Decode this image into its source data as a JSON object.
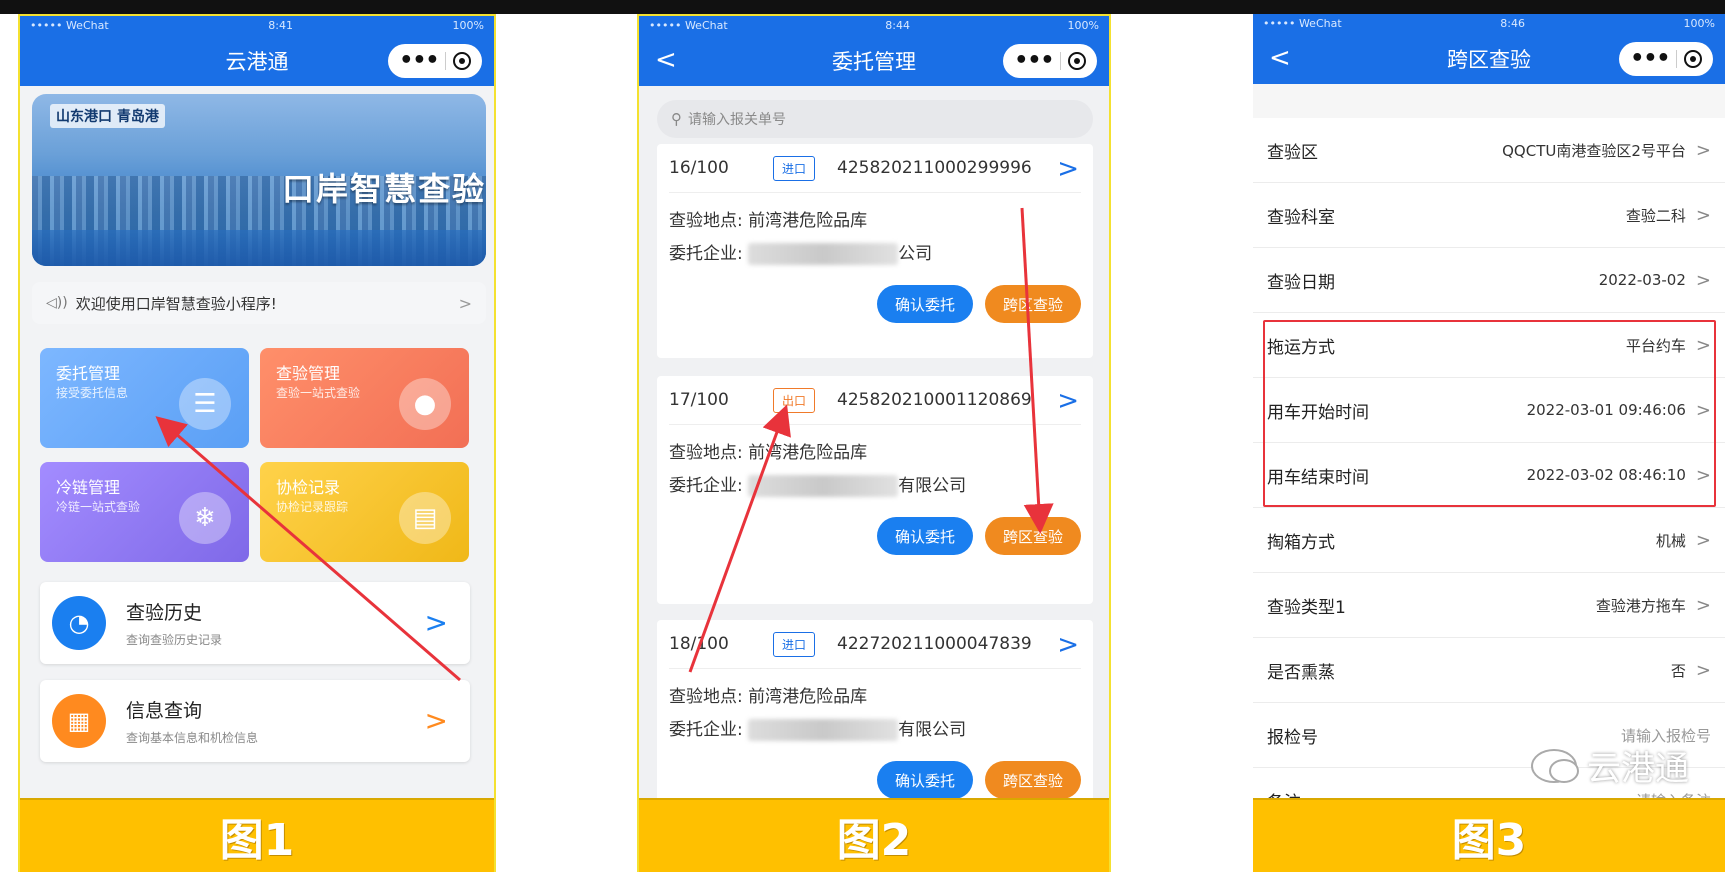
{
  "phones": {
    "p1": {
      "status": {
        "carrier": "••••• WeChat",
        "time": "8:41",
        "battery": "100%"
      },
      "title": "云港通",
      "banner": {
        "logo": "山东港口 青岛港",
        "title": "口岸智慧查验"
      },
      "notice": "欢迎使用口岸智慧查验小程序!",
      "tiles": [
        {
          "title": "委托管理",
          "subtitle": "接受委托信息",
          "icon": "hand-icon"
        },
        {
          "title": "查验管理",
          "subtitle": "查验一站式查验",
          "icon": "person-icon"
        },
        {
          "title": "冷链管理",
          "subtitle": "冷链一站式查验",
          "icon": "snowflake-icon"
        },
        {
          "title": "协检记录",
          "subtitle": "协检记录跟踪",
          "icon": "clipboard-icon"
        }
      ],
      "list": [
        {
          "title": "查验历史",
          "subtitle": "查询查验历史记录",
          "icon": "clock-icon"
        },
        {
          "title": "信息查询",
          "subtitle": "查询基本信息和机检信息",
          "icon": "layout-icon"
        }
      ],
      "figure": "图1"
    },
    "p2": {
      "status": {
        "carrier": "••••• WeChat",
        "time": "8:44",
        "battery": "100%"
      },
      "title": "委托管理",
      "search_placeholder": "请输入报关单号",
      "orders": [
        {
          "num": "16/100",
          "tag": "进口",
          "tag_type": "in",
          "code": "425820211000299996",
          "location_label": "查验地点:",
          "location": "前湾港危险品库",
          "company_label": "委托企业:",
          "company_suffix": "公司",
          "btn_confirm": "确认委托",
          "btn_cross": "跨区查验"
        },
        {
          "num": "17/100",
          "tag": "出口",
          "tag_type": "out",
          "code": "425820210001120869",
          "location_label": "查验地点:",
          "location": "前湾港危险品库",
          "company_label": "委托企业:",
          "company_suffix": "有限公司",
          "btn_confirm": "确认委托",
          "btn_cross": "跨区查验"
        },
        {
          "num": "18/100",
          "tag": "进口",
          "tag_type": "in",
          "code": "422720211000047839",
          "location_label": "查验地点:",
          "location": "前湾港危险品库",
          "company_label": "委托企业:",
          "company_suffix": "有限公司",
          "btn_confirm": "确认委托",
          "btn_cross": "跨区查验"
        }
      ],
      "figure": "图2"
    },
    "p3": {
      "status": {
        "carrier": "••••• WeChat",
        "time": "8:46",
        "battery": "100%"
      },
      "title": "跨区查验",
      "rows": [
        {
          "label": "查验区",
          "value": "QQCTU南港查验区2号平台"
        },
        {
          "label": "查验科室",
          "value": "查验二科"
        },
        {
          "label": "查验日期",
          "value": "2022-03-02"
        },
        {
          "label": "拖运方式",
          "value": "平台约车"
        },
        {
          "label": "用车开始时间",
          "value": "2022-03-01 09:46:06"
        },
        {
          "label": "用车结束时间",
          "value": "2022-03-02 08:46:10"
        },
        {
          "label": "掏箱方式",
          "value": "机械"
        },
        {
          "label": "查验类型1",
          "value": "查验港方拖车"
        },
        {
          "label": "是否熏蒸",
          "value": "否"
        },
        {
          "label": "报检号",
          "value": "请输入报检号"
        },
        {
          "label": "备注",
          "value": "请输入备注"
        }
      ],
      "watermark": "云港通",
      "figure": "图3"
    }
  },
  "colors": {
    "header": "#1a6fe6",
    "band": "#ffc000",
    "arrow": "#e8333b",
    "highlight_box": "#e8333b"
  }
}
